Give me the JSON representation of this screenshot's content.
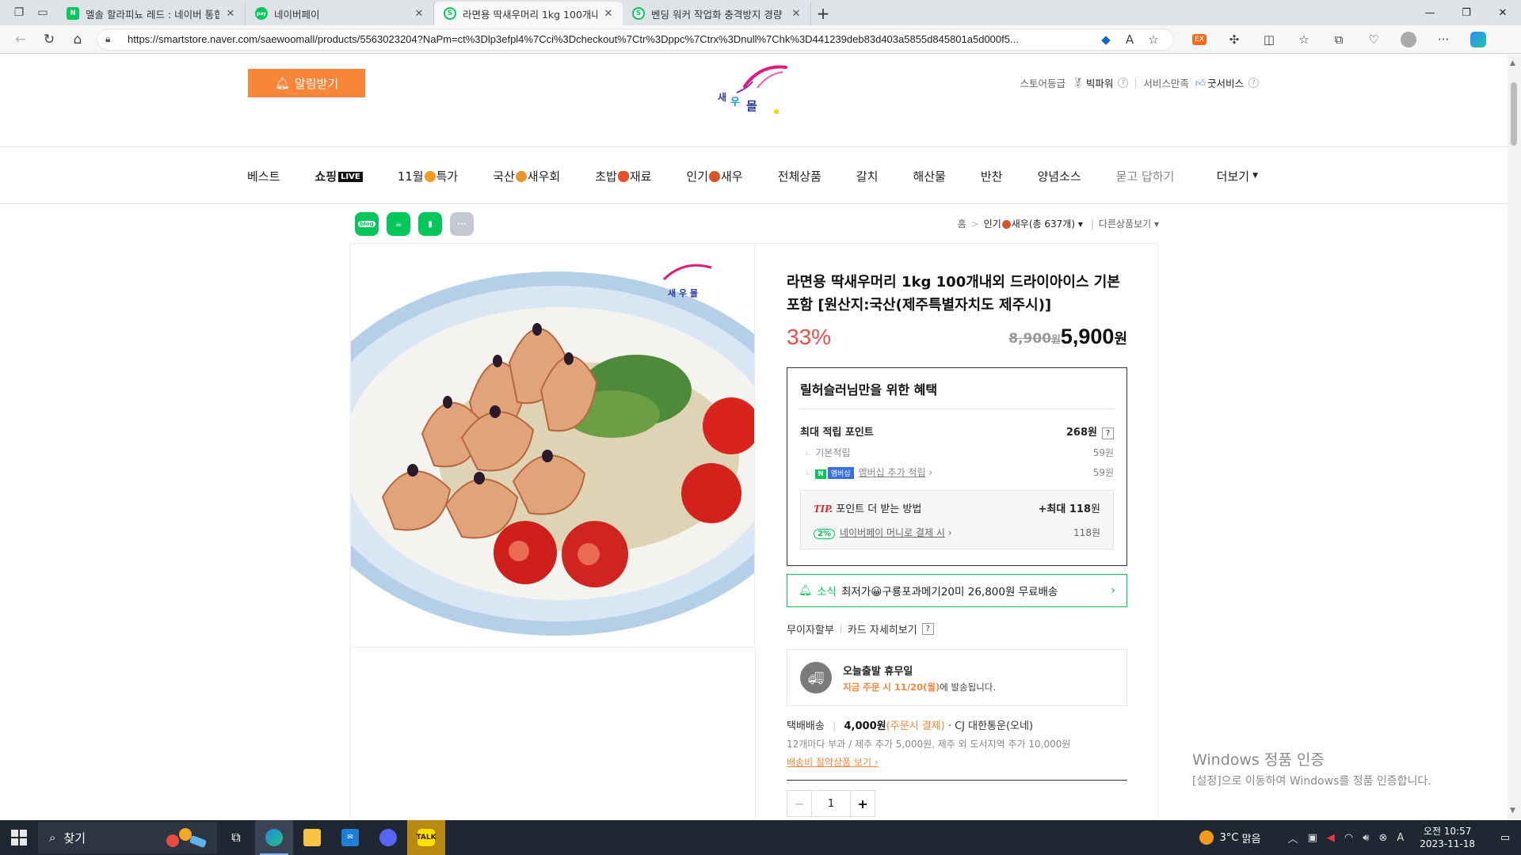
{
  "browser": {
    "tabs": [
      {
        "title": "멜솔 할라피뇨 레드 : 네이버 통합",
        "favicon": "N",
        "color": "#03c75a"
      },
      {
        "title": "네이버페이",
        "favicon": "pay",
        "color": "#03c75a"
      },
      {
        "title": "라면용 딱새우머리 1kg 100개내외",
        "favicon": "S",
        "color": "#03c75a",
        "active": true
      },
      {
        "title": "벤딩 워커 작업화 충격방지 경량",
        "favicon": "S",
        "color": "#03c75a"
      }
    ],
    "url": "https://smartstore.naver.com/saewoomall/products/5563023204?NaPm=ct%3Dlp3efpl4%7Cci%3Dcheckout%7Ctr%3Dppc%7Ctrx%3Dnull%7Chk%3D441239deb83d403a5855d845801a5d000f5..."
  },
  "store": {
    "alarm_label": "알림받기",
    "grade_label": "스토어등급",
    "grade_value": "빅파워",
    "service_label": "서비스만족",
    "service_value": "굿서비스"
  },
  "menu": {
    "items": [
      "베스트",
      "쇼핑",
      "11월",
      "특가",
      "국산",
      "새우회",
      "초밥",
      "재료",
      "인기",
      "새우",
      "전체상품",
      "갈치",
      "해산물",
      "반찬",
      "양념소스",
      "묻고 답하기"
    ],
    "live_badge": "LIVE",
    "more": "더보기"
  },
  "share": {
    "blog": "blog"
  },
  "breadcrumb": {
    "home": "홈",
    "category": "인기",
    "category_suffix": "새우(총 637개)",
    "other": "다른상품보기"
  },
  "product": {
    "title": "라면용 딱새우머리 1kg 100개내외 드라이아이스 기본 포함 [원산지:국산(제주특별자치도 제주시)]",
    "discount": "33%",
    "original_price": "8,900",
    "original_unit": "원",
    "price": "5,900",
    "price_unit": "원"
  },
  "benefit": {
    "heading": "릴허슬러님만을 위한 혜택",
    "max_points_label": "최대 적립 포인트",
    "max_points_value": "268원",
    "basic_label": "기본적립",
    "basic_value": "59원",
    "membership_label": "멤버십 추가 적립",
    "membership_chip": "멤버십",
    "membership_value": "59원",
    "tip_word": "TIP.",
    "tip_text": "포인트 더 받는 방법",
    "tip_max_prefix": "+최대",
    "tip_max_value": "118",
    "tip_max_unit": "원",
    "pay_badge": "2%",
    "pay_label": "네이버페이 머니로 결제 시",
    "pay_value": "118원"
  },
  "news": {
    "tag": "소식",
    "text": "최저가😀구룡포과메기20미 26,800원 무료배송"
  },
  "card": {
    "installment": "무이자할부",
    "detail": "카드 자세히보기"
  },
  "ship_today": {
    "title": "오늘출발 휴무일",
    "highlight": "지금 주문 시 11/20(월)",
    "rest": "에 발송됩니다."
  },
  "delivery": {
    "label": "택배배송",
    "fee": "4,000원",
    "fee_note": "(주문시 결제)",
    "courier": "· CJ 대한통운(오네)",
    "line2": "12개마다 부과 / 제주 추가 5,000원, 제주 외 도서지역 추가 10,000원",
    "line3": "배송비 절약상품 보기"
  },
  "quantity": {
    "value": "1"
  },
  "watermark": {
    "title": "Windows 정품 인증",
    "sub": "[설정]으로 이동하여 Windows를 정품 인증합니다."
  },
  "taskbar": {
    "search": "찾기",
    "weather_temp": "3°C",
    "weather_text": "맑음",
    "time": "오전 10:57",
    "date": "2023-11-18",
    "ime": "A"
  },
  "colors": {
    "naver_green": "#03c75a",
    "accent_orange": "#f7863a",
    "discount_red": "#f04a4a"
  }
}
